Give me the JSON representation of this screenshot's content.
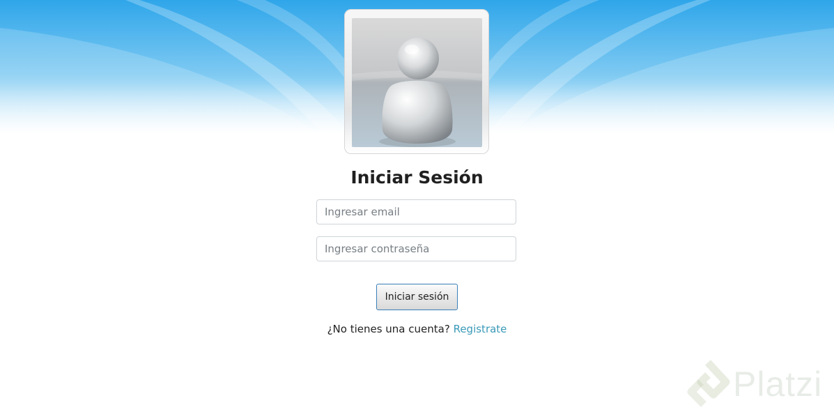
{
  "login": {
    "title": "Iniciar Sesión",
    "email_placeholder": "Ingresar email",
    "password_placeholder": "Ingresar contraseña",
    "submit_label": "Iniciar sesión",
    "register_prompt": "¿No tienes una cuenta?",
    "register_link": "Registrate"
  },
  "avatar": {
    "icon": "user-silhouette-icon"
  },
  "watermark": {
    "brand": "Platzi",
    "icon": "platzi-logo-icon"
  },
  "colors": {
    "sky_blue": "#35a9e8",
    "link": "#3a99b8",
    "button_border": "#3b7fb8"
  }
}
